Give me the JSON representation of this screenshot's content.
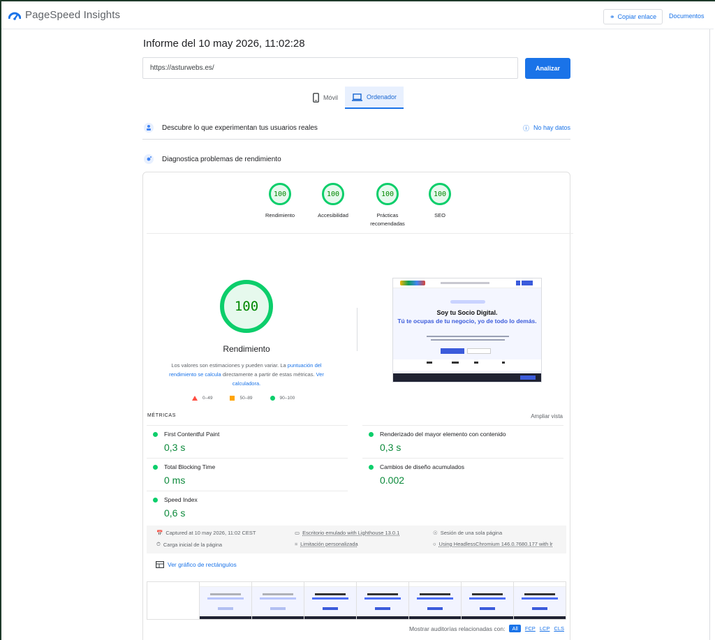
{
  "header": {
    "brand": "PageSpeed Insights",
    "copy_link": "Copiar enlace",
    "docs": "Documentos"
  },
  "report": {
    "title": "Informe del 10 may 2026, 11:02:28",
    "url_value": "https://asturwebs.es/",
    "analyze_label": "Analizar"
  },
  "tabs": [
    {
      "label": "Móvil",
      "active": false
    },
    {
      "label": "Ordenador",
      "active": true
    }
  ],
  "crux": {
    "title": "Descubre lo que experimentan tus usuarios reales",
    "no_data": "No hay datos"
  },
  "diagnostics": {
    "title": "Diagnostica problemas de rendimiento"
  },
  "categories": [
    {
      "score": "100",
      "label": "Rendimiento"
    },
    {
      "score": "100",
      "label": "Accesibilidad"
    },
    {
      "score": "100",
      "label": "Prácticas recomendadas"
    },
    {
      "score": "100",
      "label": "SEO"
    }
  ],
  "performance": {
    "score": "100",
    "label": "Rendimiento",
    "note_prefix": "Los valores son estimaciones y pueden variar. La ",
    "note_link1": "puntuación del rendimiento se calcula",
    "note_middle": " directamente a partir de estas métricas. ",
    "note_link2": "Ver calculadora.",
    "legend": {
      "poor": "0–49",
      "average": "50–89",
      "good": "90–100"
    }
  },
  "screenshot": {
    "title": "Soy tu Socio Digital.",
    "subtitle": "Tú te ocupas de tu negocio, yo de todo lo demás."
  },
  "metrics": {
    "heading": "MÉTRICAS",
    "expand": "Ampliar vista",
    "items": [
      {
        "name": "First Contentful Paint",
        "value": "0,3 s"
      },
      {
        "name": "Renderizado del mayor elemento con contenido",
        "value": "0,3 s"
      },
      {
        "name": "Total Blocking Time",
        "value": "0 ms"
      },
      {
        "name": "Cambios de diseño acumulados",
        "value": "0.002"
      },
      {
        "name": "Speed Index",
        "value": "0,6 s"
      }
    ]
  },
  "runtime": {
    "captured": "Captured at 10 may 2026, 11:02 CEST",
    "device": "Escritorio emulado with Lighthouse 13.0.1",
    "session": "Sesión de una sola página",
    "load": "Carga inicial de la página",
    "throttling": "Limitación personalizada",
    "browser": "Using HeadlessChromium 146.0.7680.177 with lr"
  },
  "treemap": "Ver gráfico de rectángulos",
  "audits_filter": {
    "label": "Mostrar auditorías relacionadas con:",
    "chips": [
      "All",
      "FCP",
      "LCP",
      "CLS"
    ]
  },
  "colors": {
    "good": "#0cce6b",
    "accent": "#1a73e8"
  }
}
